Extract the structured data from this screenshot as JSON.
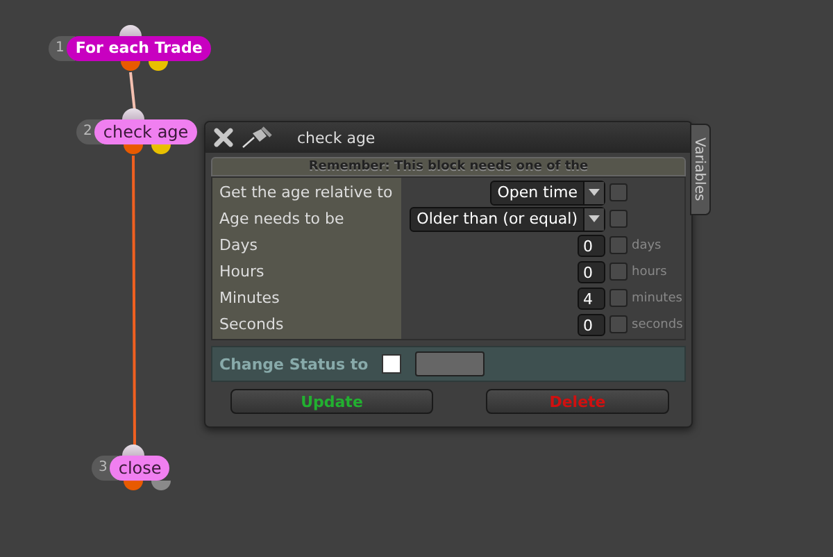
{
  "nodes": [
    {
      "number": "1",
      "label": "For each Trade",
      "kind": "loop",
      "outputs": [
        {
          "color": "#e85a00"
        },
        {
          "color": "#e8c000"
        }
      ]
    },
    {
      "number": "2",
      "label": "check age",
      "kind": "condition",
      "outputs": [
        {
          "color": "#e85a00"
        },
        {
          "color": "#e8c000"
        }
      ]
    },
    {
      "number": "3",
      "label": "close",
      "kind": "action",
      "outputs": [
        {
          "color": "#e85a00"
        },
        {
          "color": "#8a8a8a"
        }
      ]
    }
  ],
  "dialog": {
    "title": "check age",
    "side_tab": "Variables",
    "notice": "Remember: This block needs one of the",
    "rows": [
      {
        "kind": "select",
        "label": "Get the age relative to",
        "value": "Open time",
        "checked": false
      },
      {
        "kind": "select",
        "label": "Age needs to be",
        "value": "Older than (or equal)",
        "checked": false
      },
      {
        "kind": "number",
        "label": "Days",
        "value": "0",
        "checked": false,
        "unit": "days"
      },
      {
        "kind": "number",
        "label": "Hours",
        "value": "0",
        "checked": false,
        "unit": "hours"
      },
      {
        "kind": "number",
        "label": "Minutes",
        "value": "4",
        "checked": false,
        "unit": "minutes"
      },
      {
        "kind": "number",
        "label": "Seconds",
        "value": "0",
        "checked": false,
        "unit": "seconds"
      }
    ],
    "status_label": "Change Status to",
    "status_checked": false,
    "buttons": [
      {
        "label": "Update",
        "kind": "update"
      },
      {
        "label": "Delete",
        "kind": "delete"
      }
    ]
  }
}
